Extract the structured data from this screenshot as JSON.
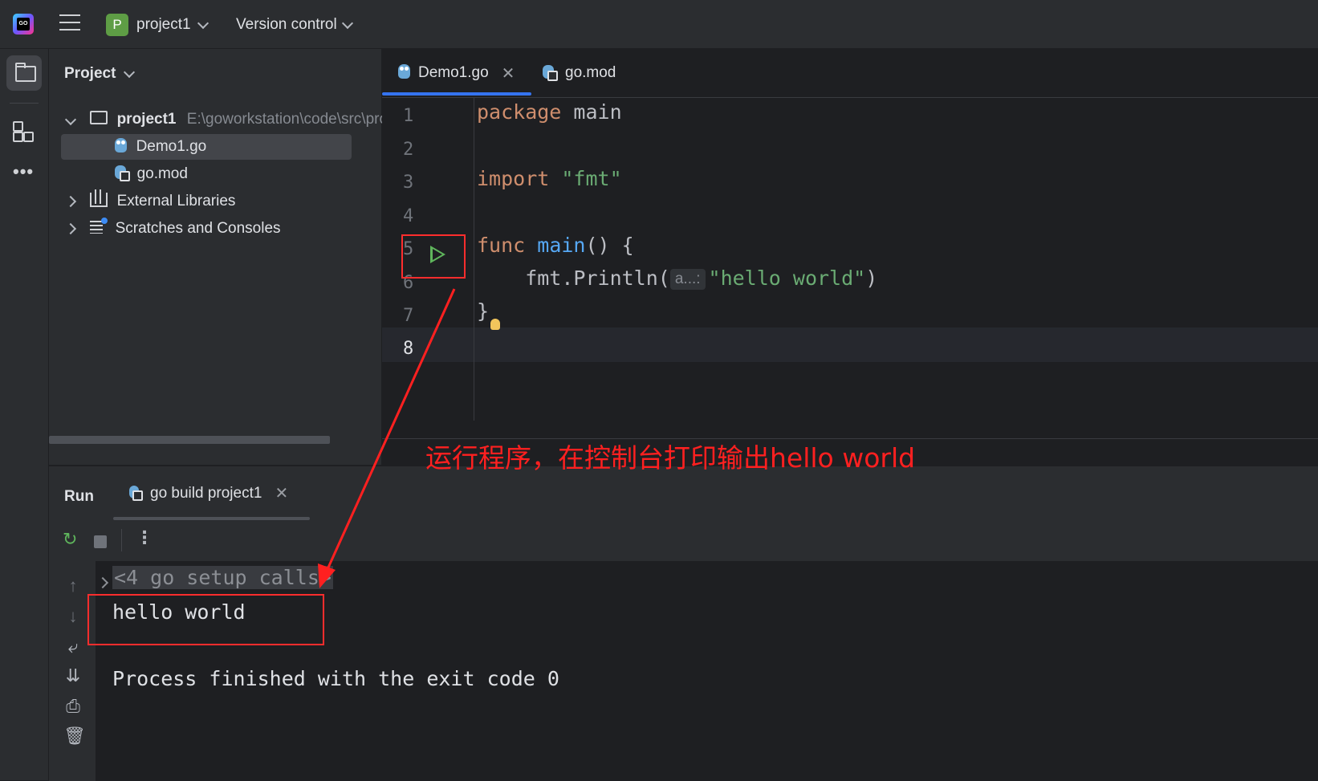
{
  "topbar": {
    "project_badge": "P",
    "project_name": "project1",
    "version_control": "Version control"
  },
  "project_panel": {
    "title": "Project",
    "tree": {
      "root_name": "project1",
      "root_path": "E:\\goworkstation\\code\\src\\pro",
      "files": [
        "Demo1.go",
        "go.mod"
      ],
      "external_libraries": "External Libraries",
      "scratches": "Scratches and Consoles"
    }
  },
  "editor": {
    "tabs": [
      {
        "label": "Demo1.go",
        "active": true
      },
      {
        "label": "go.mod",
        "active": false
      }
    ],
    "line_numbers": [
      "1",
      "2",
      "3",
      "4",
      "5",
      "6",
      "7",
      "8"
    ],
    "code": {
      "l1_kw": "package",
      "l1_rest": " main",
      "l3_kw": "import",
      "l3_str": " \"fmt\"",
      "l5_kw": "func",
      "l5_fn": " main",
      "l5_rest": "() {",
      "l6_pkg": "    fmt.",
      "l6_fn": "Println",
      "l6_open": "(",
      "l6_hint": "a...:",
      "l6_str": "\"hello world\"",
      "l6_close": ")",
      "l7": "}"
    }
  },
  "annotation": {
    "text": "运行程序，在控制台打印输出hello world",
    "color": "#ff2020"
  },
  "run_panel": {
    "title": "Run",
    "tab_label": "go build project1",
    "console": {
      "setup_calls": "<4 go setup calls>",
      "output": "hello world",
      "exit_message": "Process finished with the exit code 0"
    }
  },
  "colors": {
    "keyword": "#cf8e6d",
    "string": "#6aab73",
    "function": "#56a8f5",
    "accent": "#3574f0",
    "run_green": "#5fb55c"
  }
}
